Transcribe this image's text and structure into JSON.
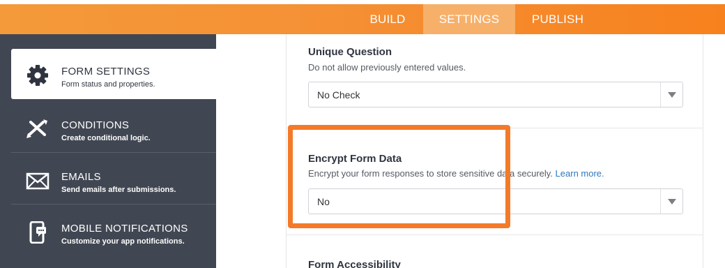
{
  "topbar": {
    "tabs": [
      {
        "label": "BUILD"
      },
      {
        "label": "SETTINGS"
      },
      {
        "label": "PUBLISH"
      }
    ]
  },
  "sidebar": {
    "items": [
      {
        "title": "FORM SETTINGS",
        "subtitle": "Form status and properties.",
        "icon": "gear-icon"
      },
      {
        "title": "CONDITIONS",
        "subtitle": "Create conditional logic.",
        "icon": "conditions-icon"
      },
      {
        "title": "EMAILS",
        "subtitle": "Send emails after submissions.",
        "icon": "envelope-icon"
      },
      {
        "title": "MOBILE NOTIFICATIONS",
        "subtitle": "Customize your app notifications.",
        "icon": "mobile-notification-icon"
      }
    ]
  },
  "main": {
    "unique_question": {
      "title": "Unique Question",
      "description": "Do not allow previously entered values.",
      "value": "No Check"
    },
    "encrypt": {
      "title": "Encrypt Form Data",
      "description": "Encrypt your form responses to store sensitive data securely.",
      "link": "Learn more.",
      "value": "No"
    },
    "accessibility": {
      "title": "Form Accessibility"
    }
  },
  "colors": {
    "accent_orange": "#f7811d",
    "active_tab": "#f7b06a",
    "sidebar_bg": "#414752",
    "highlight_border": "#f47a29",
    "link": "#2d77bf"
  }
}
